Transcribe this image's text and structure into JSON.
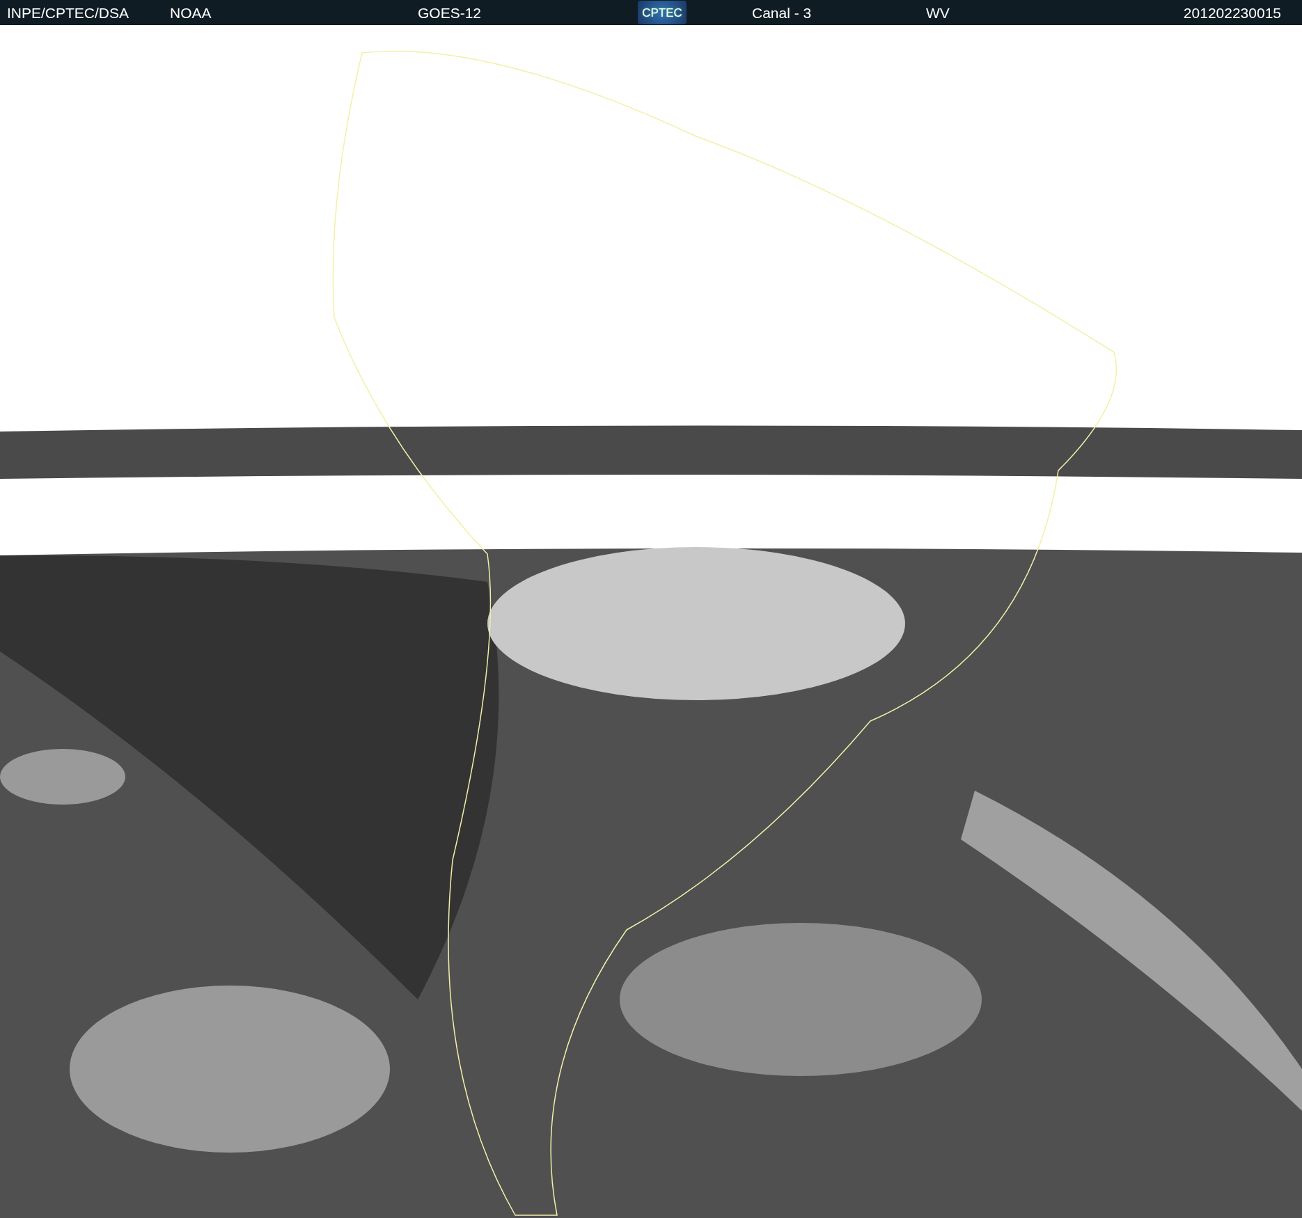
{
  "header": {
    "source": "INPE/CPTEC/DSA",
    "agency": "NOAA",
    "satellite": "GOES-12",
    "logo": "CPTEC",
    "channel": "Canal - 3",
    "band": "WV",
    "timestamp": "201202230015"
  }
}
